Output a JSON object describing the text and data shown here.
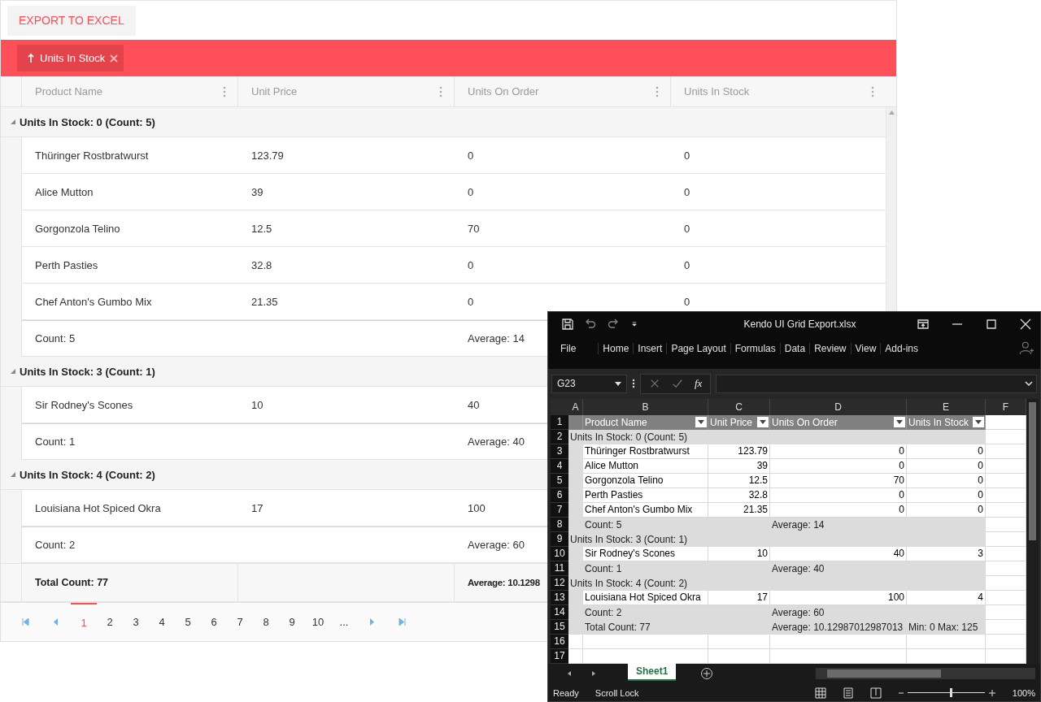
{
  "toolbar": {
    "export_button": "EXPORT TO EXCEL"
  },
  "group_panel": {
    "indicators": [
      {
        "label": "Units In Stock",
        "ascending": true
      }
    ]
  },
  "grid": {
    "columns": [
      {
        "title": "Product Name"
      },
      {
        "title": "Unit Price"
      },
      {
        "title": "Units On Order"
      },
      {
        "title": "Units In Stock"
      }
    ],
    "groups": [
      {
        "title": "Units In Stock: 0 (Count: 5)",
        "expanded": true,
        "rows": [
          [
            "Thüringer Rostbratwurst",
            "123.79",
            "0",
            "0"
          ],
          [
            "Alice Mutton",
            "39",
            "0",
            "0"
          ],
          [
            "Gorgonzola Telino",
            "12.5",
            "70",
            "0"
          ],
          [
            "Perth Pasties",
            "32.8",
            "0",
            "0"
          ],
          [
            "Chef Anton's Gumbo Mix",
            "21.35",
            "0",
            "0"
          ]
        ],
        "footer": {
          "count": "Count: 5",
          "average": "Average: 14"
        }
      },
      {
        "title": "Units In Stock: 3 (Count: 1)",
        "expanded": true,
        "rows": [
          [
            "Sir Rodney's Scones",
            "10",
            "40"
          ]
        ],
        "footer": {
          "count": "Count: 1",
          "average": "Average: 40"
        }
      },
      {
        "title": "Units In Stock: 4 (Count: 2)",
        "expanded": true,
        "rows": [
          [
            "Louisiana Hot Spiced Okra",
            "17",
            "100"
          ]
        ],
        "footer": {
          "count": "Count: 2",
          "average": "Average: 60"
        }
      }
    ],
    "total": {
      "count": "Total Count: 77",
      "average": "Average: 10.1298"
    }
  },
  "pager": {
    "pages": [
      {
        "label": "1",
        "selected": true
      },
      {
        "label": "2",
        "selected": false
      },
      {
        "label": "3",
        "selected": false
      },
      {
        "label": "4",
        "selected": false
      },
      {
        "label": "5",
        "selected": false
      },
      {
        "label": "6",
        "selected": false
      },
      {
        "label": "7",
        "selected": false
      },
      {
        "label": "8",
        "selected": false
      },
      {
        "label": "9",
        "selected": false
      },
      {
        "label": "10",
        "selected": false
      },
      {
        "label": "...",
        "selected": false
      }
    ]
  },
  "excel": {
    "title": "Kendo UI Grid Export.xlsx",
    "menu": [
      "File",
      "Home",
      "Insert",
      "Page Layout",
      "Formulas",
      "Data",
      "Review",
      "View",
      "Add-ins"
    ],
    "name_box": "G23",
    "function_button": "fx",
    "columns": [
      "A",
      "B",
      "C",
      "D",
      "E",
      "F"
    ],
    "rows": [
      {
        "number": "1",
        "kind": "header",
        "cells": [
          "Product Name",
          "Unit Price",
          "Units On Order",
          "Units In Stock"
        ]
      },
      {
        "number": "2",
        "kind": "group",
        "cells": [
          "Units In Stock: 0 (Count: 5)"
        ]
      },
      {
        "number": "3",
        "kind": "data",
        "cells": [
          "Thüringer Rostbratwurst",
          "123.79",
          "0",
          "0"
        ]
      },
      {
        "number": "4",
        "kind": "data",
        "cells": [
          "Alice Mutton",
          "39",
          "0",
          "0"
        ]
      },
      {
        "number": "5",
        "kind": "data",
        "cells": [
          "Gorgonzola Telino",
          "12.5",
          "70",
          "0"
        ]
      },
      {
        "number": "6",
        "kind": "data",
        "cells": [
          "Perth Pasties",
          "32.8",
          "0",
          "0"
        ]
      },
      {
        "number": "7",
        "kind": "data",
        "cells": [
          "Chef Anton's Gumbo Mix",
          "21.35",
          "0",
          "0"
        ]
      },
      {
        "number": "8",
        "kind": "footer",
        "cells": [
          "Count: 5",
          "Average: 14"
        ]
      },
      {
        "number": "9",
        "kind": "group",
        "cells": [
          "Units In Stock: 3 (Count: 1)"
        ]
      },
      {
        "number": "10",
        "kind": "data",
        "cells": [
          "Sir Rodney's Scones",
          "10",
          "40",
          "3"
        ]
      },
      {
        "number": "11",
        "kind": "footer",
        "cells": [
          "Count: 1",
          "Average: 40"
        ]
      },
      {
        "number": "12",
        "kind": "group",
        "cells": [
          "Units In Stock: 4 (Count: 2)"
        ]
      },
      {
        "number": "13",
        "kind": "data",
        "cells": [
          "Louisiana Hot Spiced Okra",
          "17",
          "100",
          "4"
        ]
      },
      {
        "number": "14",
        "kind": "footer",
        "cells": [
          "Count: 2",
          "Average: 60"
        ]
      },
      {
        "number": "15",
        "kind": "footer",
        "cells": [
          "Total Count: 77",
          "Average: 10.12987012987013",
          "Min: 0 Max: 125"
        ]
      },
      {
        "number": "16",
        "kind": "empty"
      },
      {
        "number": "17",
        "kind": "empty"
      }
    ],
    "sheets": [
      {
        "label": "Sheet1",
        "selected": true
      }
    ],
    "status": [
      "Ready",
      "Scroll Lock"
    ],
    "zoom_slider": {
      "level": 0.55
    },
    "zoom": "100%"
  }
}
